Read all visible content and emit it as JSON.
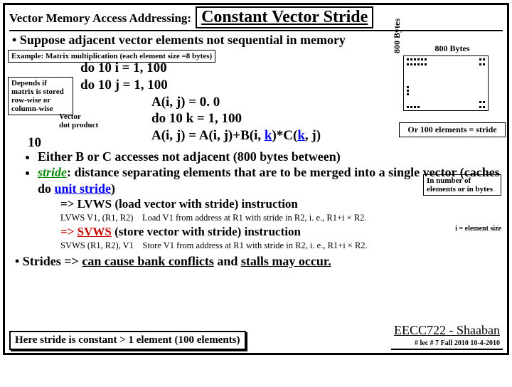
{
  "header": {
    "left": "Vector Memory Access Addressing:",
    "right": "Constant Vector Stride"
  },
  "bullet_top": "• Suppose adjacent vector elements not sequential in memory",
  "example_box": "Example: Matrix multiplication (each element size =8 bytes)",
  "code": {
    "l1": "do 10 i = 1, 100",
    "l2": "do 10 j = 1, 100",
    "l3": "A(i, j) = 0. 0",
    "l4": "do 10 k = 1, 100",
    "l5_pre": "A(i, j) = A(i, j)+B(i, ",
    "l5_k1": "k",
    "l5_mid": ")*C(",
    "l5_k2": "k",
    "l5_post": ", j)"
  },
  "depends": "Depends if matrix is stored row-wise or column-wise",
  "vecdot": "Vector\ndot product",
  "ten": "10",
  "matrix": {
    "top": "800 Bytes",
    "left": "800 Bytes",
    "or100": "Or 100 elements = stride"
  },
  "bullets2": {
    "b1": "Either B or C accesses not adjacent (800 bytes between)",
    "b2_stride": "stride",
    "b2_rest": ": distance separating elements that are to be merged into a single vector (caches do ",
    "b2_unit": "unit stride",
    "b2_end": ")",
    "lvws": "=> LVWS (load vector with stride) instruction",
    "svws_pre": "=> ",
    "svws": "SVWS",
    "svws_post": " (store vector with stride) instruction"
  },
  "inbox": "In number of elements or in bytes",
  "instr": {
    "lvws_sig": "LVWS V1, (R1, R2)",
    "lvws_desc": "Load V1 from address at R1 with stride in R2, i. e., R1+i × R2.",
    "svws_sig": "SVWS (R1, R2), V1",
    "svws_desc": "Store V1 from address at R1 with stride in R2, i. e., R1+i × R2.",
    "isize": "i = element size"
  },
  "last_bullet": "• Strides => can cause bank conflicts and stalls may occur.",
  "footer": "Here stride is constant > 1 element (100 elements)",
  "course": {
    "name": "EECC722 - Shaaban",
    "sub": "# lec # 7   Fall 2010   10-4-2010"
  }
}
